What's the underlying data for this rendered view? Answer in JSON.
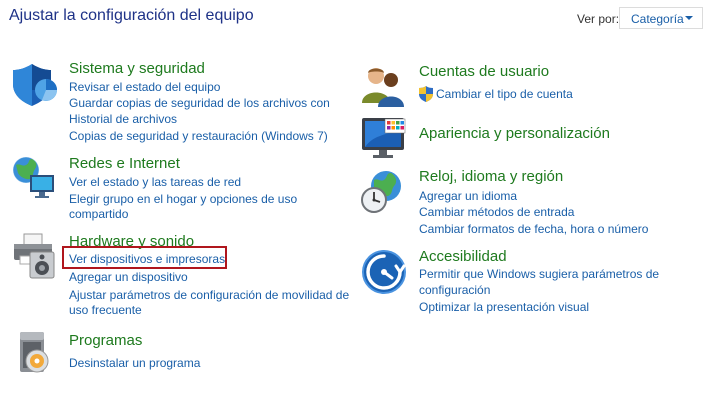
{
  "page_title": "Ajustar la configuración del equipo",
  "view": {
    "label": "Ver por:",
    "selected": "Categoría"
  },
  "categories": {
    "system": {
      "title": "Sistema y seguridad",
      "links": [
        "Revisar el estado del equipo",
        "Guardar copias de seguridad de los archivos con",
        "Historial de archivos",
        "Copias de seguridad y restauración (Windows 7)"
      ]
    },
    "network": {
      "title": "Redes e Internet",
      "links": [
        "Ver el estado y las tareas de red",
        "Elegir grupo en el hogar y opciones de uso",
        "compartido"
      ]
    },
    "hardware": {
      "title": "Hardware y sonido",
      "links": [
        "Ver dispositivos e impresoras",
        "Agregar un dispositivo",
        "Ajustar parámetros de configuración de movilidad de",
        "uso frecuente"
      ]
    },
    "programs": {
      "title": "Programas",
      "links": [
        "Desinstalar un programa"
      ]
    },
    "accounts": {
      "title": "Cuentas de usuario",
      "links": [
        "Cambiar el tipo de cuenta"
      ]
    },
    "appearance": {
      "title": "Apariencia y personalización",
      "links": []
    },
    "clock": {
      "title": "Reloj, idioma y región",
      "links": [
        "Agregar un idioma",
        "Cambiar métodos de entrada",
        "Cambiar formatos de fecha, hora o número"
      ]
    },
    "accessibility": {
      "title": "Accesibilidad",
      "links": [
        "Permitir que Windows sugiera parámetros de",
        "configuración",
        "Optimizar la presentación visual"
      ]
    }
  },
  "colors": {
    "title": "#1e3287",
    "category": "#1e7a1e",
    "link": "#1a5fa8",
    "highlight": "#b0161d"
  }
}
